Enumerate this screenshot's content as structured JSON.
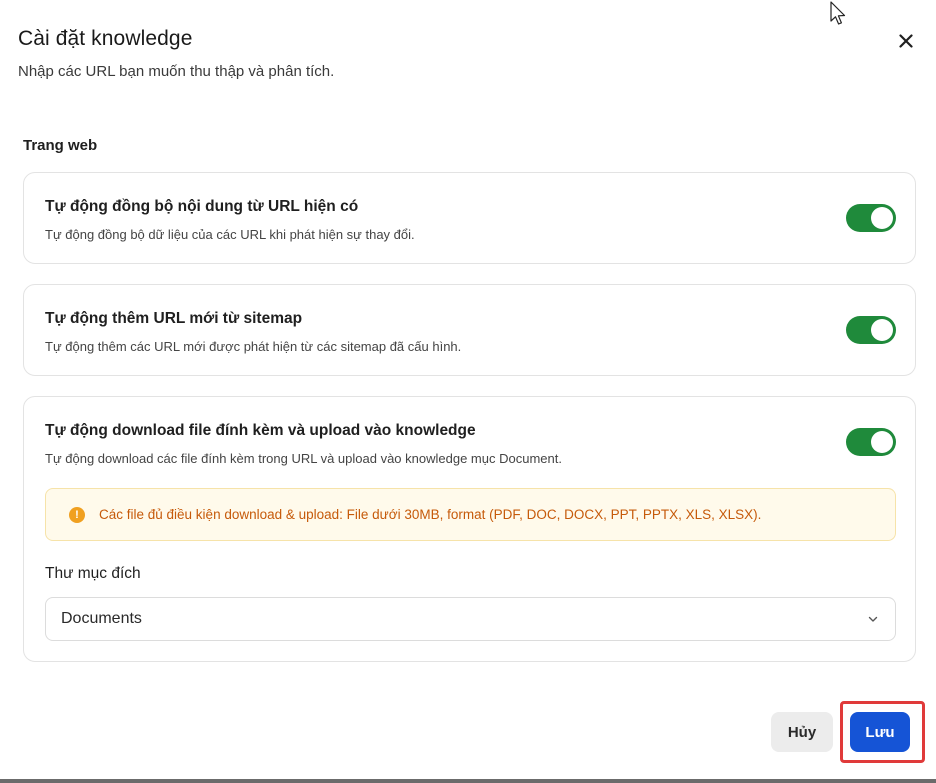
{
  "dialog": {
    "title": "Cài đặt knowledge",
    "subtitle": "Nhập các URL bạn muốn thu thập và phân tích."
  },
  "section": {
    "label": "Trang web"
  },
  "settings": [
    {
      "title": "Tự động đồng bộ nội dung từ URL hiện có",
      "description": "Tự động đồng bộ dữ liệu của các URL khi phát hiện sự thay đổi.",
      "enabled": true
    },
    {
      "title": "Tự động thêm URL mới từ sitemap",
      "description": "Tự động thêm các URL mới được phát hiện từ các sitemap đã cấu hình.",
      "enabled": true
    },
    {
      "title": "Tự động download file đính kèm và upload vào knowledge",
      "description": "Tự động download các file đính kèm trong URL và upload vào knowledge mục Document.",
      "enabled": true
    }
  ],
  "notice": {
    "icon": "warning-circle-icon",
    "text": "Các file đủ điều kiện download & upload: File dưới 30MB, format (PDF, DOC, DOCX, PPT, PPTX, XLS, XLSX)."
  },
  "folder": {
    "label": "Thư mục đích",
    "selected": "Documents"
  },
  "buttons": {
    "cancel": "Hủy",
    "save": "Lưu"
  },
  "colors": {
    "toggle_on": "#1f8a3b",
    "primary": "#1554d6",
    "notice_bg": "#fffaeb",
    "notice_text": "#c65a0a",
    "warning_icon": "#f0a020",
    "highlight": "#e03a3a"
  }
}
